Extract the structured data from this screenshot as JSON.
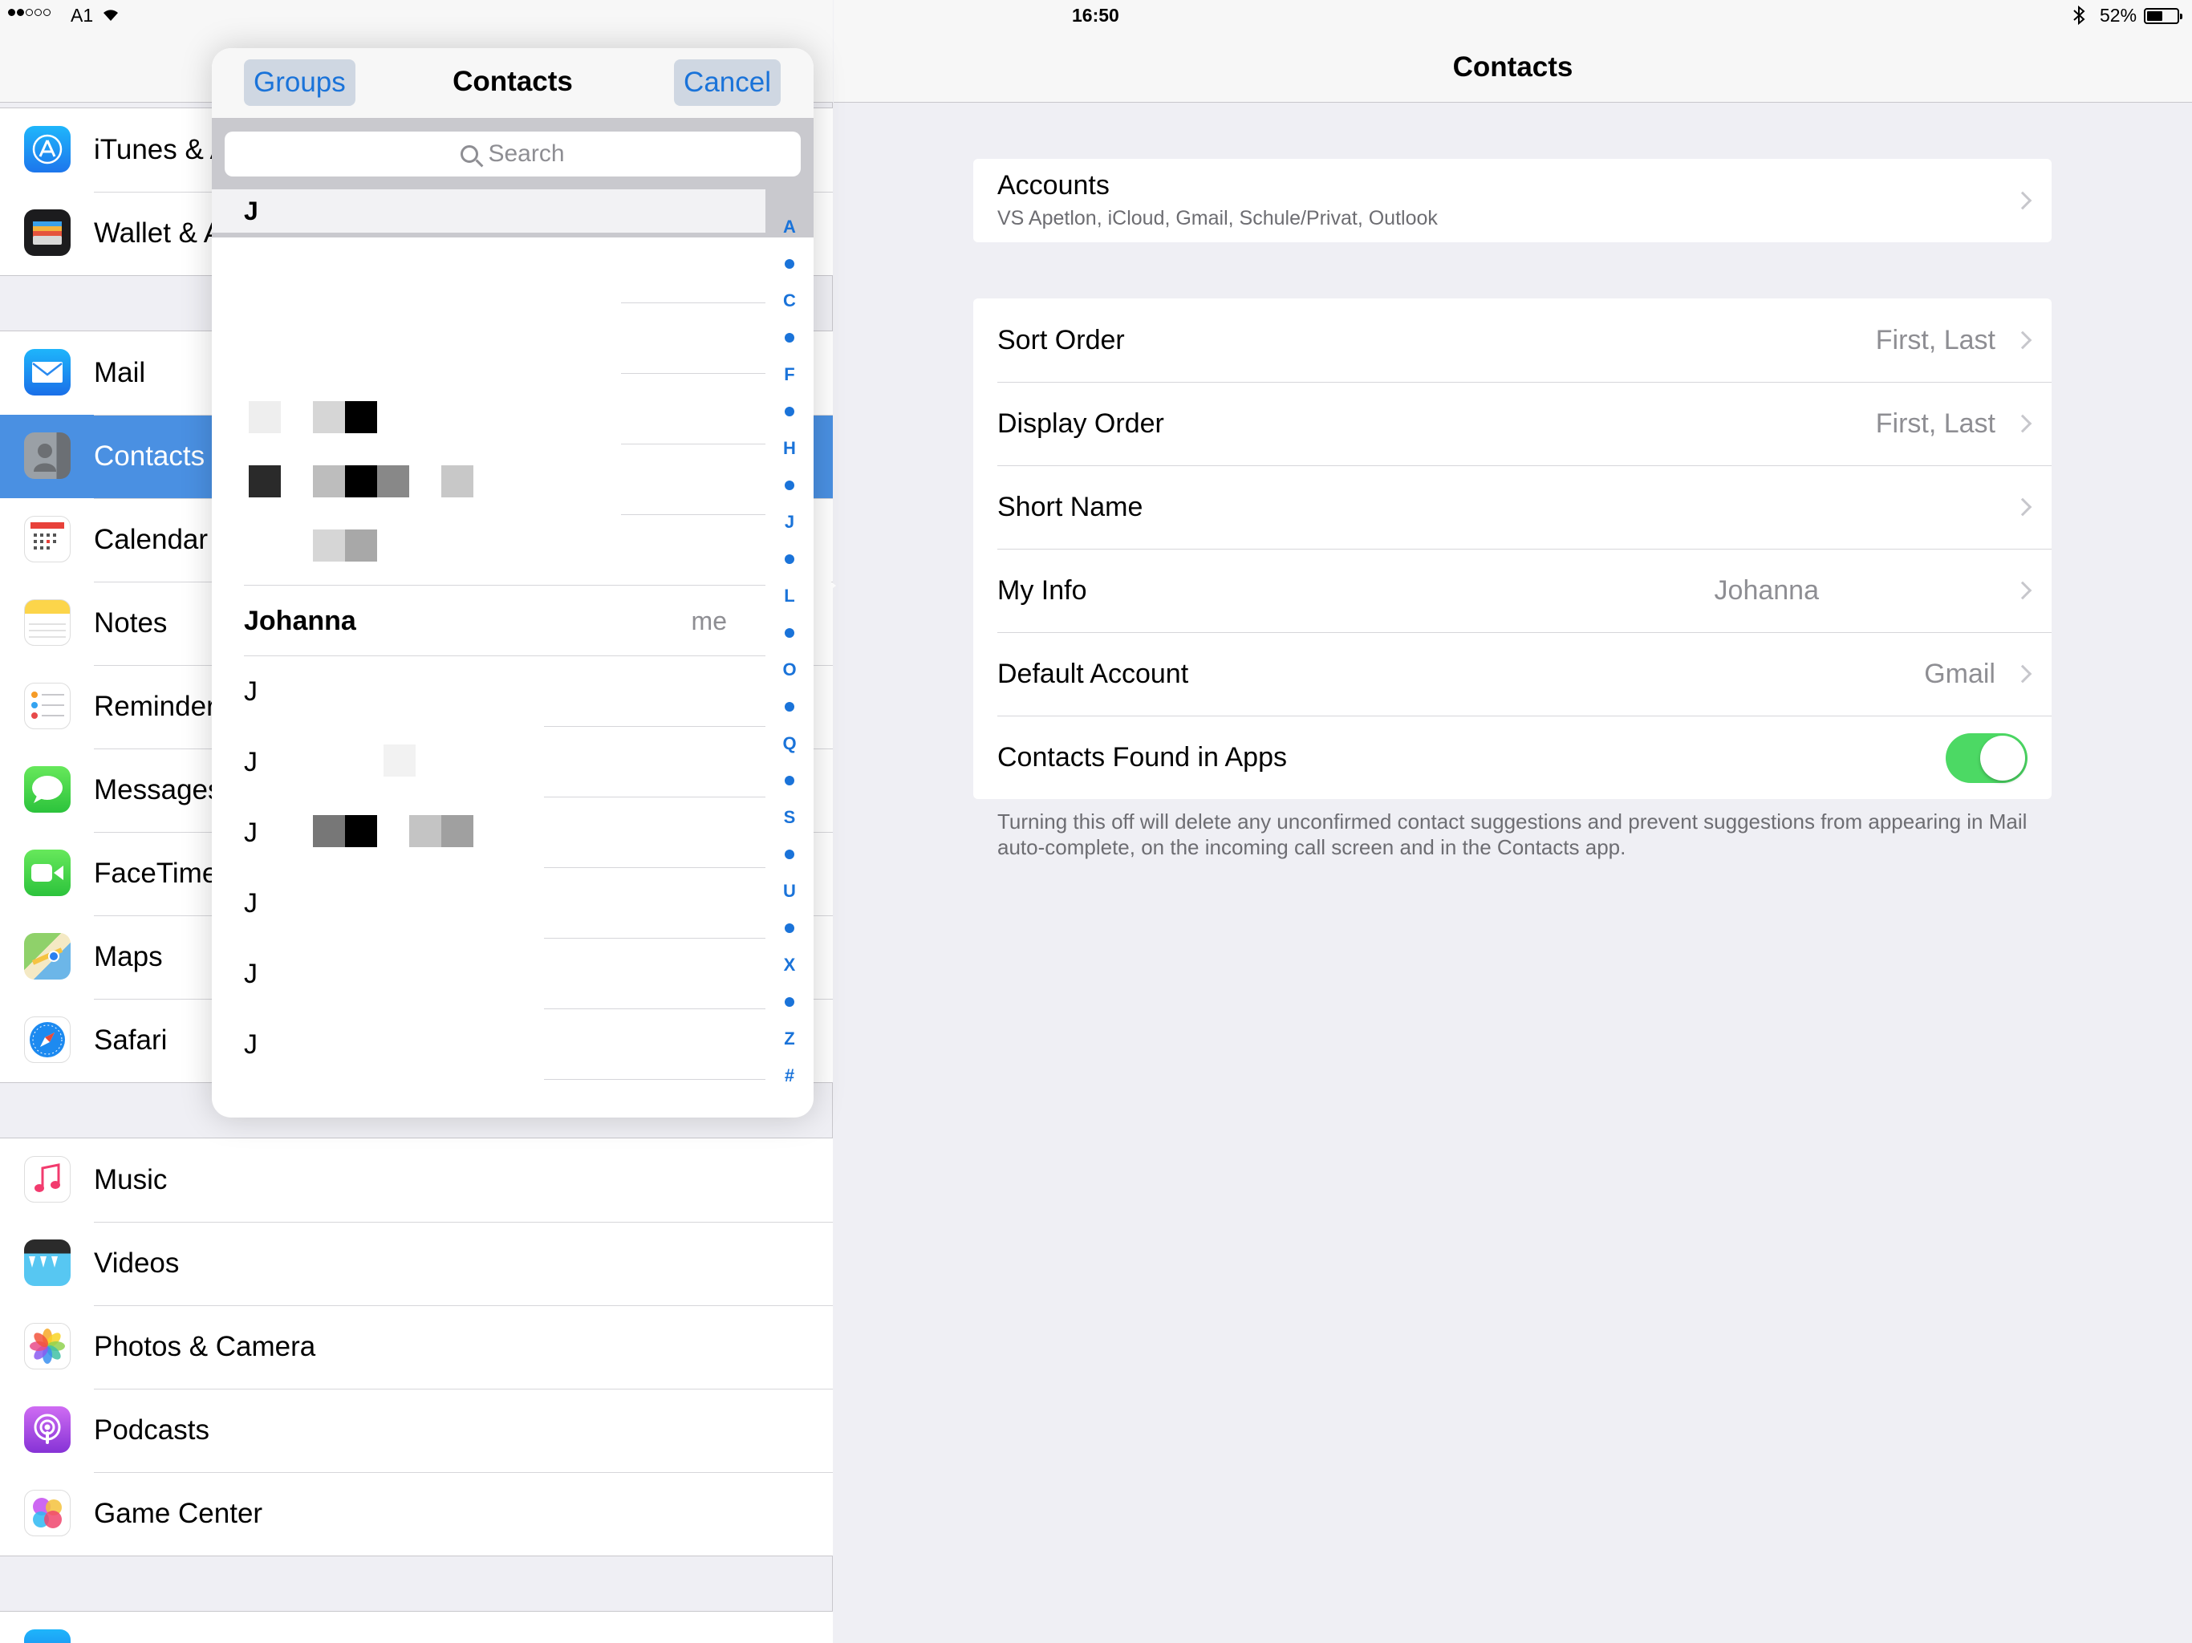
{
  "status_bar": {
    "carrier": "A1",
    "time": "16:50",
    "battery_text": "52%",
    "battery_level": 0.52,
    "bluetooth_icon": "bluetooth-icon",
    "wifi_icon": "wifi-icon"
  },
  "sidebar": {
    "group1": [
      {
        "label": "iTunes & A",
        "icon": "app-store-icon"
      },
      {
        "label": "Wallet & A",
        "icon": "wallet-icon"
      }
    ],
    "group2": [
      {
        "label": "Mail",
        "icon": "mail-icon"
      },
      {
        "label": "Contacts",
        "icon": "contacts-icon",
        "selected": true
      },
      {
        "label": "Calendar",
        "icon": "calendar-icon"
      },
      {
        "label": "Notes",
        "icon": "notes-icon"
      },
      {
        "label": "Reminder",
        "icon": "reminders-icon"
      },
      {
        "label": "Messages",
        "icon": "messages-icon"
      },
      {
        "label": "FaceTime",
        "icon": "facetime-icon"
      },
      {
        "label": "Maps",
        "icon": "maps-icon"
      },
      {
        "label": "Safari",
        "icon": "safari-icon"
      }
    ],
    "group3": [
      {
        "label": "Music",
        "icon": "music-icon"
      },
      {
        "label": "Videos",
        "icon": "videos-icon"
      },
      {
        "label": "Photos & Camera",
        "icon": "photos-icon"
      },
      {
        "label": "Podcasts",
        "icon": "podcasts-icon"
      },
      {
        "label": "Game Center",
        "icon": "game-center-icon"
      }
    ]
  },
  "popover": {
    "title": "Contacts",
    "groups_label": "Groups",
    "cancel_label": "Cancel",
    "search_placeholder": "Search",
    "section_header": "J",
    "me_contact": {
      "name": "Johanna",
      "badge": "me"
    },
    "contacts_after": [
      "J",
      "J",
      "J",
      "J",
      "J",
      "J"
    ],
    "index_letters": [
      "A",
      "C",
      "F",
      "H",
      "J",
      "L",
      "O",
      "Q",
      "S",
      "U",
      "X",
      "Z",
      "#"
    ]
  },
  "detail": {
    "title": "Contacts",
    "accounts": {
      "label": "Accounts",
      "sub": "VS Apetlon, iCloud, Gmail, Schule/Privat, Outlook"
    },
    "rows": [
      {
        "label": "Sort Order",
        "value": "First, Last"
      },
      {
        "label": "Display Order",
        "value": "First, Last"
      },
      {
        "label": "Short Name",
        "value": ""
      },
      {
        "label": "My Info",
        "value": "Johanna"
      },
      {
        "label": "Default Account",
        "value": "Gmail"
      }
    ],
    "toggle_row": {
      "label": "Contacts Found in Apps",
      "on": true
    },
    "footer": "Turning this off will delete any unconfirmed contact suggestions and prevent suggestions from appearing in Mail auto-complete, on the incoming call screen and in the Contacts app."
  },
  "colors": {
    "accent": "#1a73d9",
    "selected_row": "#4a90e2",
    "toggle_on": "#4cd964"
  }
}
